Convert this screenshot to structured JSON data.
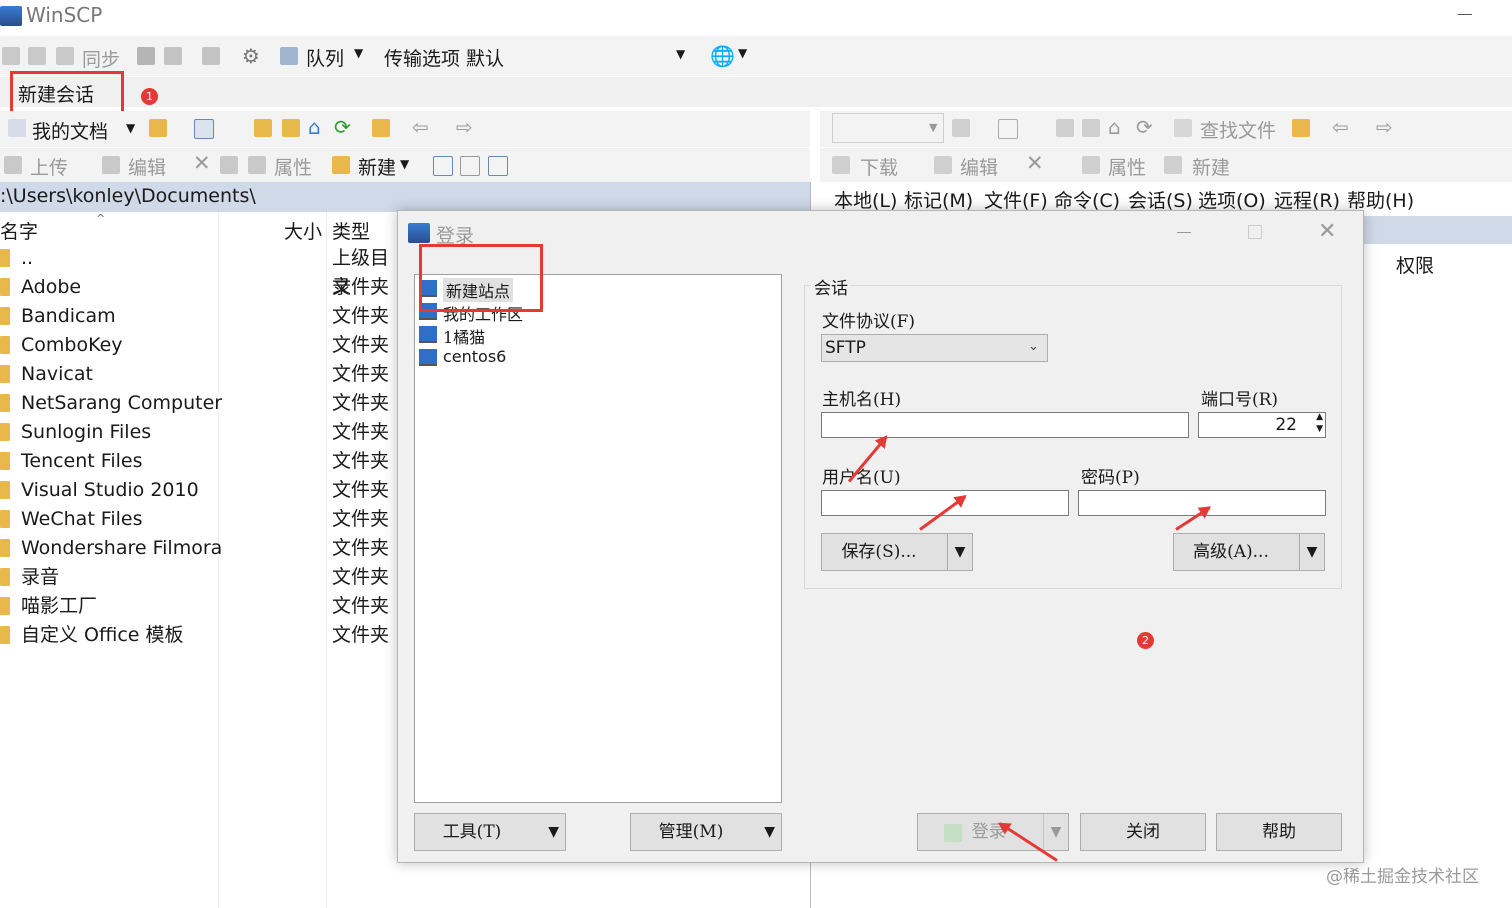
{
  "app": {
    "title": "WinSCP"
  },
  "toolbar1": {
    "sync_label": "同步",
    "queue_label": "队列",
    "transfer_label": "传输选项",
    "transfer_value": "默认"
  },
  "tabs": {
    "new_session": "新建会话"
  },
  "left": {
    "location": "我的文档",
    "upload": "上传",
    "edit": "编辑",
    "props": "属性",
    "new": "新建",
    "path": ":\\Users\\konley\\Documents\\",
    "columns": {
      "name": "名字",
      "size": "大小",
      "type": "类型"
    },
    "rows": [
      {
        "name": "..",
        "type": "上级目录"
      },
      {
        "name": "Adobe",
        "type": "文件夹"
      },
      {
        "name": "Bandicam",
        "type": "文件夹"
      },
      {
        "name": "ComboKey",
        "type": "文件夹"
      },
      {
        "name": "Navicat",
        "type": "文件夹"
      },
      {
        "name": "NetSarang Computer",
        "type": "文件夹"
      },
      {
        "name": "Sunlogin Files",
        "type": "文件夹"
      },
      {
        "name": "Tencent Files",
        "type": "文件夹"
      },
      {
        "name": "Visual Studio 2010",
        "type": "文件夹"
      },
      {
        "name": "WeChat Files",
        "type": "文件夹"
      },
      {
        "name": "Wondershare Filmora",
        "type": "文件夹"
      },
      {
        "name": "录音",
        "type": "文件夹"
      },
      {
        "name": "喵影工厂",
        "type": "文件夹"
      },
      {
        "name": "自定义 Office 模板",
        "type": "文件夹"
      }
    ]
  },
  "right": {
    "find_files": "查找文件",
    "download": "下载",
    "edit": "编辑",
    "props": "属性",
    "new": "新建",
    "menu": [
      "本地(L)",
      "标记(M)",
      "文件(F)",
      "命令(C)",
      "会话(S)",
      "选项(O)",
      "远程(R)",
      "帮助(H)"
    ],
    "perm_col": "权限"
  },
  "dialog": {
    "title": "登录",
    "sites": [
      "新建站点",
      "我的工作区",
      "1橘猫",
      "centos6"
    ],
    "session_group": "会话",
    "protocol_label": "文件协议(F)",
    "protocol_value": "SFTP",
    "host_label": "主机名(H)",
    "host_value": "",
    "port_label": "端口号(R)",
    "port_value": "22",
    "user_label": "用户名(U)",
    "user_value": "",
    "pass_label": "密码(P)",
    "pass_value": "",
    "save_btn": "保存(S)...",
    "advanced_btn": "高级(A)...",
    "tools_btn": "工具(T)",
    "manage_btn": "管理(M)",
    "login_btn": "登录",
    "close_btn": "关闭",
    "help_btn": "帮助"
  },
  "annotations": {
    "badge1": "1",
    "badge2": "2"
  },
  "watermark": "@稀土掘金技术社区",
  "colors": {
    "highlight_red": "#e53935",
    "folder": "#e8b84a",
    "path_bar": "#cfd9e8"
  }
}
